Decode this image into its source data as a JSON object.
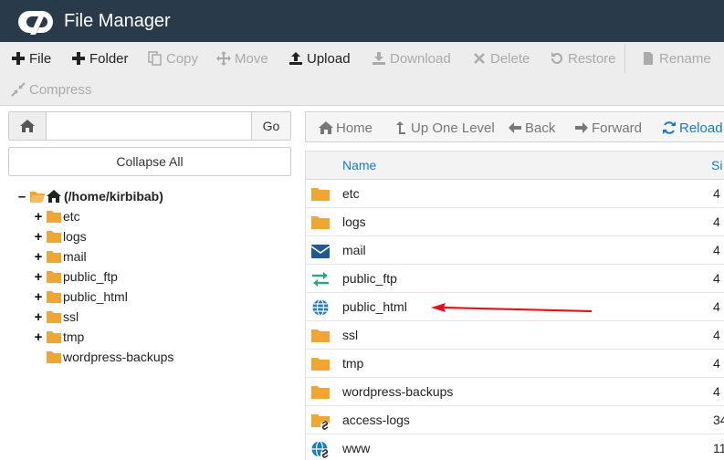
{
  "header": {
    "title": "File Manager"
  },
  "toolbar": {
    "buttons": [
      {
        "label": "File",
        "icon": "plus-icon",
        "enabled": true
      },
      {
        "label": "Folder",
        "icon": "plus-icon",
        "enabled": true
      },
      {
        "label": "Copy",
        "icon": "copy-icon",
        "enabled": false
      },
      {
        "label": "Move",
        "icon": "move-icon",
        "enabled": false
      },
      {
        "label": "Upload",
        "icon": "upload-icon",
        "enabled": true
      },
      {
        "label": "Download",
        "icon": "download-icon",
        "enabled": false
      },
      {
        "label": "Delete",
        "icon": "delete-icon",
        "enabled": false
      },
      {
        "label": "Restore",
        "icon": "restore-icon",
        "enabled": false
      },
      {
        "label": "Rename",
        "icon": "file-icon",
        "enabled": false
      },
      {
        "label": "Compress",
        "icon": "compress-icon",
        "enabled": false
      }
    ]
  },
  "left": {
    "path_value": "",
    "go_label": "Go",
    "collapse_label": "Collapse All",
    "tree_root": "(/home/kirbibab)",
    "tree_items": [
      {
        "label": "etc",
        "expandable": true
      },
      {
        "label": "logs",
        "expandable": true
      },
      {
        "label": "mail",
        "expandable": true
      },
      {
        "label": "public_ftp",
        "expandable": true
      },
      {
        "label": "public_html",
        "expandable": true
      },
      {
        "label": "ssl",
        "expandable": true
      },
      {
        "label": "tmp",
        "expandable": true
      },
      {
        "label": "wordpress-backups",
        "expandable": false
      }
    ]
  },
  "nav": {
    "home": "Home",
    "up": "Up One Level",
    "back": "Back",
    "forward": "Forward",
    "reload": "Reload"
  },
  "table": {
    "col_name": "Name",
    "col_size": "Si",
    "rows": [
      {
        "name": "etc",
        "size": "4",
        "icon": "folder-icon"
      },
      {
        "name": "logs",
        "size": "4",
        "icon": "folder-icon"
      },
      {
        "name": "mail",
        "size": "4",
        "icon": "mail-icon"
      },
      {
        "name": "public_ftp",
        "size": "4",
        "icon": "transfer-icon"
      },
      {
        "name": "public_html",
        "size": "4",
        "icon": "globe-icon"
      },
      {
        "name": "ssl",
        "size": "4",
        "icon": "folder-icon"
      },
      {
        "name": "tmp",
        "size": "4",
        "icon": "folder-icon"
      },
      {
        "name": "wordpress-backups",
        "size": "4",
        "icon": "folder-icon"
      },
      {
        "name": "access-logs",
        "size": "34",
        "icon": "folder-link-icon"
      },
      {
        "name": "www",
        "size": "11",
        "icon": "globe-link-icon"
      }
    ]
  },
  "colors": {
    "header_bg": "#293a4a",
    "accent": "#1a7ac6",
    "folder": "#f0a631",
    "annotation_arrow": "#e8101a"
  }
}
